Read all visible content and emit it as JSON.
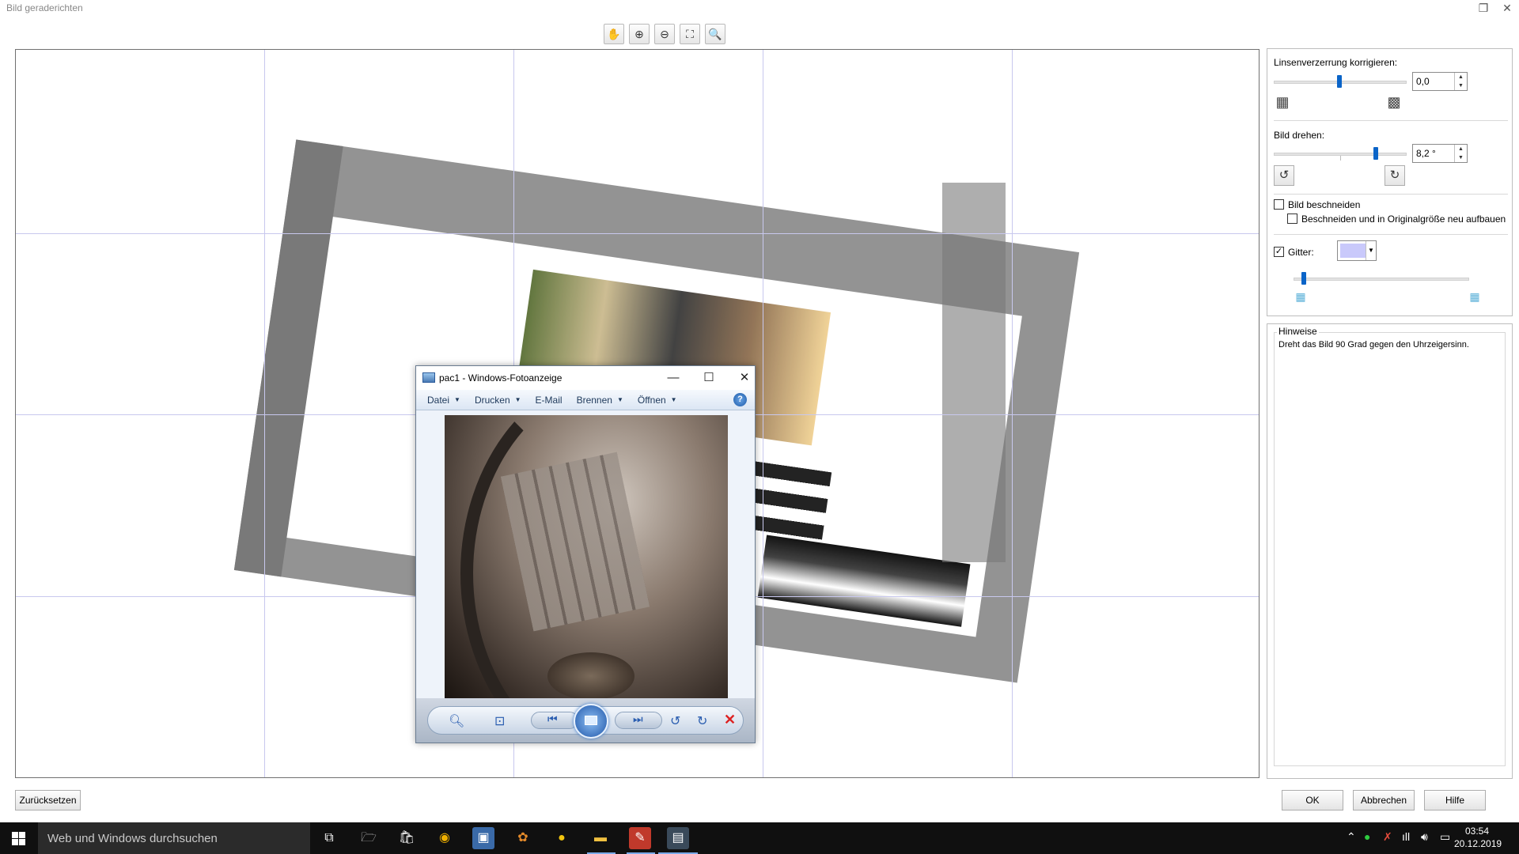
{
  "window": {
    "title": "Bild geraderichten"
  },
  "toolbar": {
    "icons": [
      "hand-icon",
      "zoom-in-icon",
      "zoom-out-icon",
      "fit-window-icon",
      "actual-size-icon"
    ]
  },
  "photo_viewer": {
    "title": "pac1 - Windows-Fotoanzeige",
    "menu": [
      "Datei",
      "Drucken",
      "E-Mail",
      "Brennen",
      "Öffnen"
    ],
    "help": "?"
  },
  "settings": {
    "lens_label": "Linsenverzerrung korrigieren:",
    "lens_value": "0,0",
    "lens_level": 0.5,
    "rotate_label": "Bild drehen:",
    "rotate_value": "8,2 °",
    "crop_label": "Bild beschneiden",
    "crop_checked": false,
    "crop_resize_label": "Beschneiden und in Originalgröße neu aufbauen",
    "crop_resize_checked": false,
    "grid_label": "Gitter:",
    "grid_checked": true,
    "grid_color": "#c9c9fb"
  },
  "hints": {
    "title": "Hinweise",
    "text": "Dreht das Bild 90 Grad gegen den Uhrzeigersinn."
  },
  "buttons": {
    "reset": "Zurücksetzen",
    "ok": "OK",
    "cancel": "Abbrechen",
    "help": "Hilfe"
  },
  "taskbar": {
    "search_placeholder": "Web und Windows durchsuchen",
    "time": "03:54",
    "date": "20.12.2019"
  }
}
